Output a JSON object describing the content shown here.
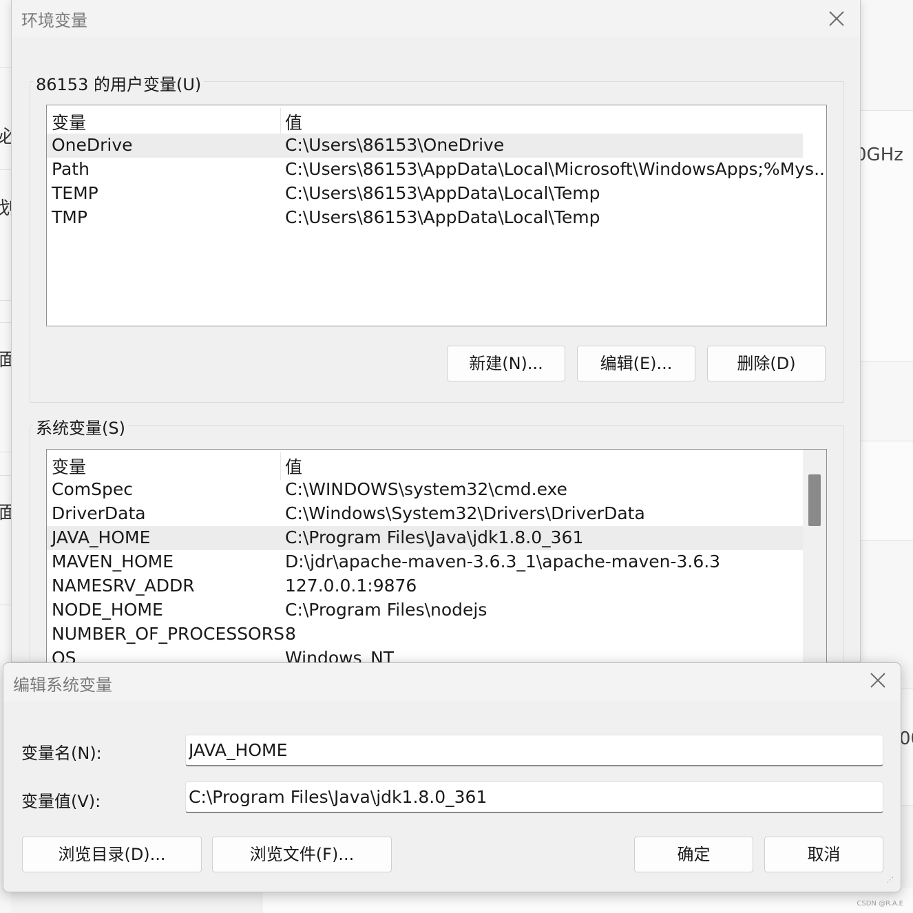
{
  "background": {
    "fragments": [
      "必",
      "划",
      "面",
      "面",
      "0GHz",
      "00"
    ]
  },
  "env_dialog": {
    "title": "环境变量",
    "user_vars": {
      "group_label": "86153 的用户变量(U)",
      "col_var": "变量",
      "col_val": "值",
      "rows": [
        {
          "name": "OneDrive",
          "value": "C:\\Users\\86153\\OneDrive"
        },
        {
          "name": "Path",
          "value": "C:\\Users\\86153\\AppData\\Local\\Microsoft\\WindowsApps;%Mys..."
        },
        {
          "name": "TEMP",
          "value": "C:\\Users\\86153\\AppData\\Local\\Temp"
        },
        {
          "name": "TMP",
          "value": "C:\\Users\\86153\\AppData\\Local\\Temp"
        }
      ],
      "btn_new": "新建(N)...",
      "btn_edit": "编辑(E)...",
      "btn_delete": "删除(D)"
    },
    "system_vars": {
      "group_label": "系统变量(S)",
      "col_var": "变量",
      "col_val": "值",
      "rows": [
        {
          "name": "ComSpec",
          "value": "C:\\WINDOWS\\system32\\cmd.exe"
        },
        {
          "name": "DriverData",
          "value": "C:\\Windows\\System32\\Drivers\\DriverData"
        },
        {
          "name": "JAVA_HOME",
          "value": "C:\\Program Files\\Java\\jdk1.8.0_361"
        },
        {
          "name": "MAVEN_HOME",
          "value": "D:\\jdr\\apache-maven-3.6.3_1\\apache-maven-3.6.3"
        },
        {
          "name": "NAMESRV_ADDR",
          "value": "127.0.0.1:9876"
        },
        {
          "name": "NODE_HOME",
          "value": "C:\\Program Files\\nodejs"
        },
        {
          "name": "NUMBER_OF_PROCESSORS",
          "value": "8"
        },
        {
          "name": "OS",
          "value": "Windows_NT"
        }
      ]
    }
  },
  "edit_dialog": {
    "title": "编辑系统变量",
    "name_label": "变量名(N):",
    "name_value": "JAVA_HOME",
    "value_label": "变量值(V):",
    "value_value": "C:\\Program Files\\Java\\jdk1.8.0_361",
    "btn_browse_dir": "浏览目录(D)...",
    "btn_browse_file": "浏览文件(F)...",
    "btn_ok": "确定",
    "btn_cancel": "取消"
  },
  "watermark": "CSDN @R.A.E"
}
